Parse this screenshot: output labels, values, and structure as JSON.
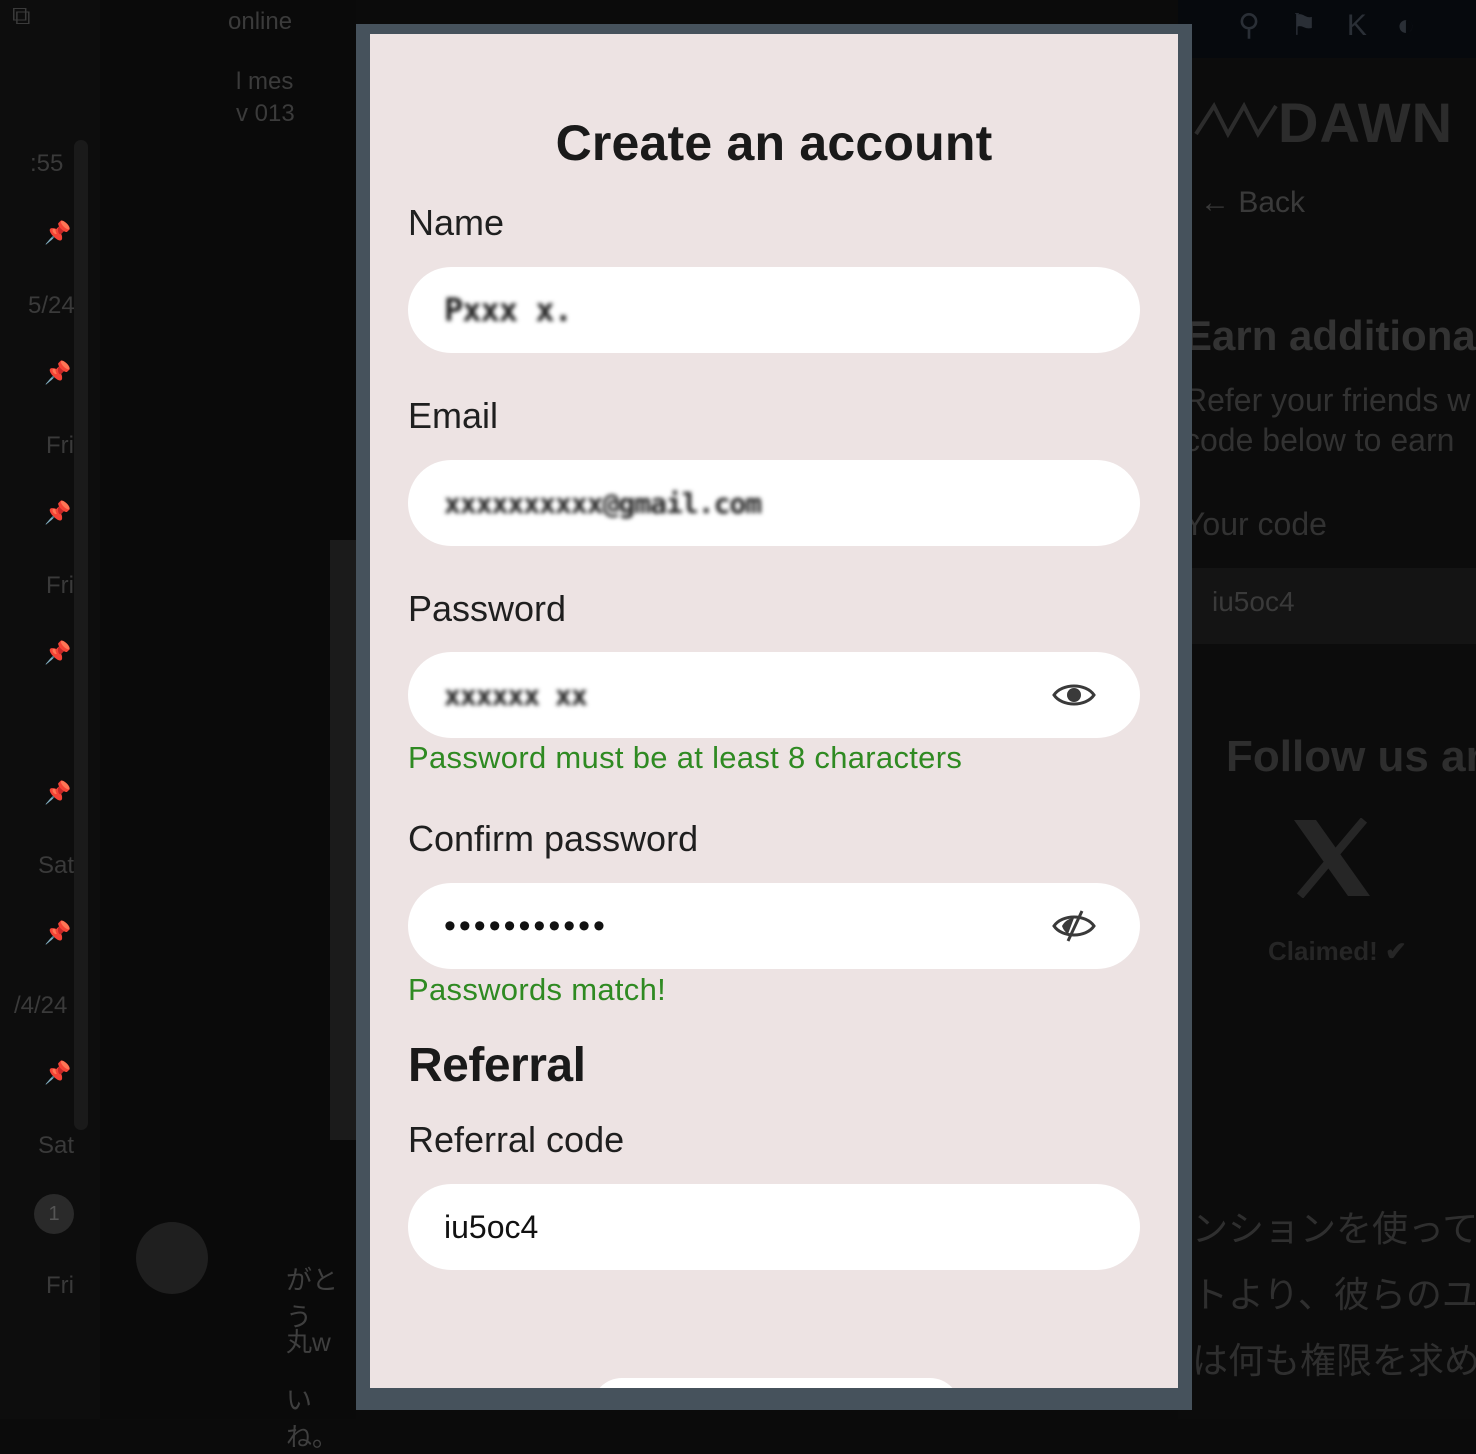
{
  "background_left": {
    "status": "online",
    "header_snippet_1": "l mes",
    "header_snippet_2": "v 013",
    "dates": [
      ":55",
      "5/24",
      "Fri",
      "Fri",
      "Sat",
      "/4/24",
      "Sat",
      "Fri"
    ],
    "unread_count": "1",
    "snippets": [
      "がとう",
      "丸w",
      "いね。"
    ]
  },
  "background_right": {
    "logo_text": "DAWN",
    "back_label": "Back",
    "earn_title": "Earn additional",
    "refer_line_1": "Refer your friends w",
    "refer_line_2": "code below to earn",
    "your_code_label": "Your code",
    "your_code_value": "iu5oc4",
    "follow_title": "Follow us an",
    "claimed_label": "Claimed! ✔",
    "jp_lines": [
      "ンションを使って",
      "トより、彼らのユ",
      "は何も権限を求めて"
    ]
  },
  "modal": {
    "title": "Create an account",
    "name": {
      "label": "Name",
      "value": "Pxxx  x."
    },
    "email": {
      "label": "Email",
      "value": "xxxxxxxxxx@gmail.com"
    },
    "password": {
      "label": "Password",
      "value": "xxxxxx xx",
      "hint": "Password must be at least 8 characters",
      "hint_color": "#2f8a22",
      "toggle_icon": "eye-icon"
    },
    "confirm_password": {
      "label": "Confirm password",
      "value": "•••••••••••",
      "hint": "Passwords match!",
      "hint_color": "#2f8a22",
      "toggle_icon": "eye-slash-icon"
    },
    "referral": {
      "section_title": "Referral",
      "code_label": "Referral code",
      "code_value": "iu5oc4"
    }
  },
  "colors": {
    "modal_background": "#ede3e3",
    "modal_frame": "#46525c",
    "success_text": "#2f8a22"
  }
}
